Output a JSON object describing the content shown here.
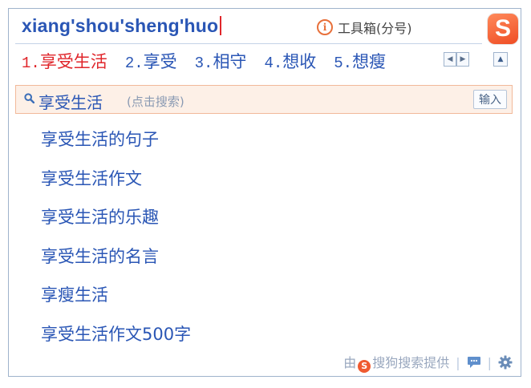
{
  "pinyin_input": "xiang'shou'sheng'huo",
  "toolbox": {
    "label": "工具箱(分号)",
    "icon": "info-icon"
  },
  "logo": {
    "glyph": "S"
  },
  "candidates": [
    {
      "num": "1.",
      "text": "享受生活",
      "active": true
    },
    {
      "num": "2.",
      "text": "享受"
    },
    {
      "num": "3.",
      "text": "相守"
    },
    {
      "num": "4.",
      "text": "想收"
    },
    {
      "num": "5.",
      "text": "想瘦"
    }
  ],
  "pager": {
    "prev": "◀",
    "next": "▶",
    "collapse": "▲"
  },
  "search": {
    "term": "享受生活",
    "hint": "(点击搜索)",
    "input_button": "输入"
  },
  "suggestions": [
    "享受生活的句子",
    "享受生活作文",
    "享受生活的乐趣",
    "享受生活的名言",
    "享瘦生活",
    "享受生活作文500字"
  ],
  "footer": {
    "prefix": "由",
    "logo_glyph": "S",
    "provider": "搜狗搜索提供",
    "separator": "|"
  },
  "colors": {
    "accent_blue": "#2a56b5",
    "active_red": "#e0262b",
    "logo_orange": "#ef4d24",
    "search_bg": "#fdf0e7"
  }
}
